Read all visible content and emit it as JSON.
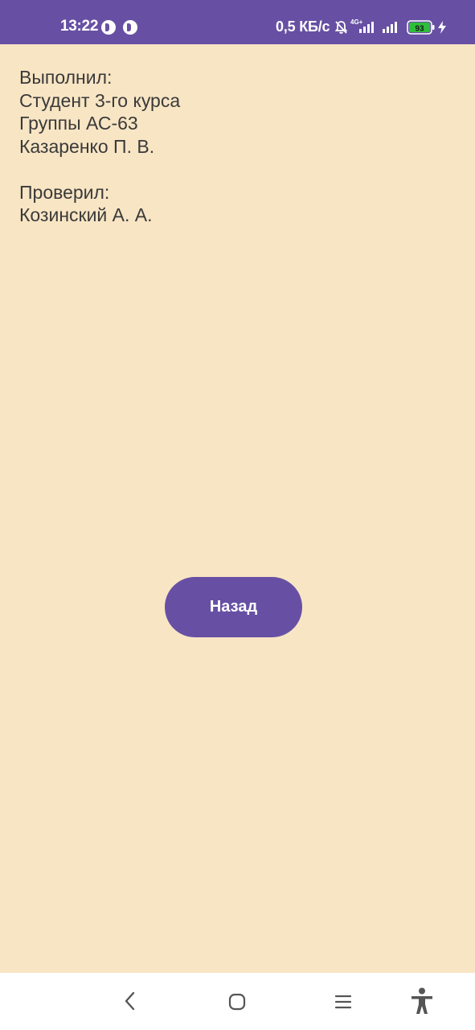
{
  "status_bar": {
    "time": "13:22",
    "network_speed": "0,5 КБ/с",
    "network_type": "4G+",
    "battery_level": "93",
    "icons": [
      "app-notification-icon",
      "app-notification-icon",
      "mute-bell-icon",
      "signal-icon",
      "signal-icon",
      "battery-icon",
      "charging-icon"
    ]
  },
  "content": {
    "lines": [
      "Выполнил:",
      "Студент 3-го курса",
      "Группы АС-63",
      "Казаренко П. В.",
      "",
      "Проверил:",
      "Козинский А. А."
    ]
  },
  "back_button": {
    "label": "Назад"
  },
  "nav_bar": {
    "icons": [
      "back-icon",
      "home-icon",
      "recents-icon",
      "accessibility-icon"
    ]
  },
  "colors": {
    "accent": "#6750A4",
    "background": "#F8E5C4",
    "text": "#3a3a3a",
    "battery_fill": "#2EBE3A"
  }
}
